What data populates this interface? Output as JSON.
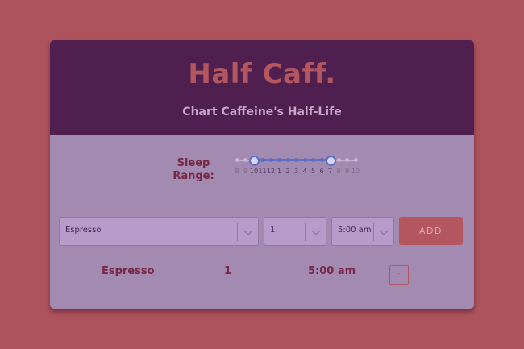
{
  "header": {
    "title": "Half Caff.",
    "subtitle": "Chart Caffeine's Half-Life"
  },
  "sleep_range": {
    "label": "Sleep Range:",
    "ticks": [
      "8",
      "9",
      "10",
      "11",
      "12",
      "1",
      "2",
      "3",
      "4",
      "5",
      "6",
      "7",
      "8",
      "9",
      "10"
    ],
    "selected_start": "10",
    "selected_end": "7"
  },
  "form": {
    "drink_value": "Espresso",
    "quantity_value": "1",
    "time_value": "5:00 am",
    "add_label": "ADD"
  },
  "entries": [
    {
      "drink": "Espresso",
      "quantity": "1",
      "time": "5:00 am",
      "remove_label": "-"
    }
  ],
  "colors": {
    "background": "#ad535c",
    "header": "#4e1f4f",
    "card": "#a38ab1",
    "accent": "#b4565f",
    "slider": "#5c6fc2"
  }
}
